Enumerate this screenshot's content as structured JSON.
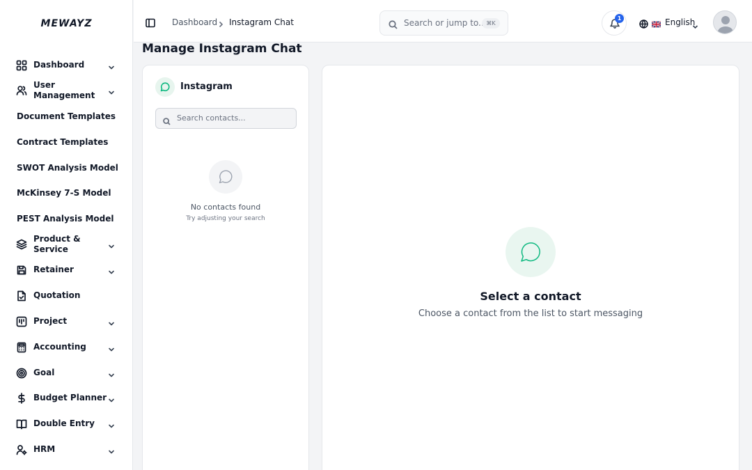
{
  "brand": {
    "logo": "MEWAYZ"
  },
  "sidebar": {
    "items": [
      {
        "label": "Dashboard",
        "icon": "grid-icon",
        "expandable": true
      },
      {
        "label": "User Management",
        "icon": "users-icon",
        "expandable": true
      },
      {
        "label": "Document Templates",
        "icon": null,
        "expandable": false
      },
      {
        "label": "Contract Templates",
        "icon": null,
        "expandable": false
      },
      {
        "label": "SWOT Analysis Model",
        "icon": null,
        "expandable": false
      },
      {
        "label": "McKinsey 7-S Model",
        "icon": null,
        "expandable": false
      },
      {
        "label": "PEST Analysis Model",
        "icon": null,
        "expandable": false
      },
      {
        "label": "Product & Service",
        "icon": "layers-icon",
        "expandable": true
      },
      {
        "label": "Retainer",
        "icon": "save-icon",
        "expandable": true
      },
      {
        "label": "Quotation",
        "icon": "file-check-icon",
        "expandable": false
      },
      {
        "label": "Project",
        "icon": "kanban-icon",
        "expandable": true
      },
      {
        "label": "Accounting",
        "icon": "calculator-icon",
        "expandable": true
      },
      {
        "label": "Goal",
        "icon": "target-icon",
        "expandable": true
      },
      {
        "label": "Budget Planner",
        "icon": "dollar-icon",
        "expandable": true
      },
      {
        "label": "Double Entry",
        "icon": "book-icon",
        "expandable": true
      },
      {
        "label": "HRM",
        "icon": "user-cog-icon",
        "expandable": true
      }
    ]
  },
  "header": {
    "breadcrumb": [
      "Dashboard",
      "Instagram Chat"
    ],
    "search_placeholder": "Search or jump to...",
    "search_shortcut": "⌘K",
    "notifications_count": "1",
    "language": "English"
  },
  "main": {
    "title": "Manage Instagram Chat",
    "contacts_panel": {
      "title": "Instagram",
      "search_placeholder": "Search contacts...",
      "empty_title": "No contacts found",
      "empty_subtitle": "Try adjusting your search"
    },
    "chat_panel": {
      "title": "Select a contact",
      "subtitle": "Choose a contact from the list to start messaging"
    }
  },
  "colors": {
    "accent": "#10b981",
    "badge": "#2563eb"
  }
}
